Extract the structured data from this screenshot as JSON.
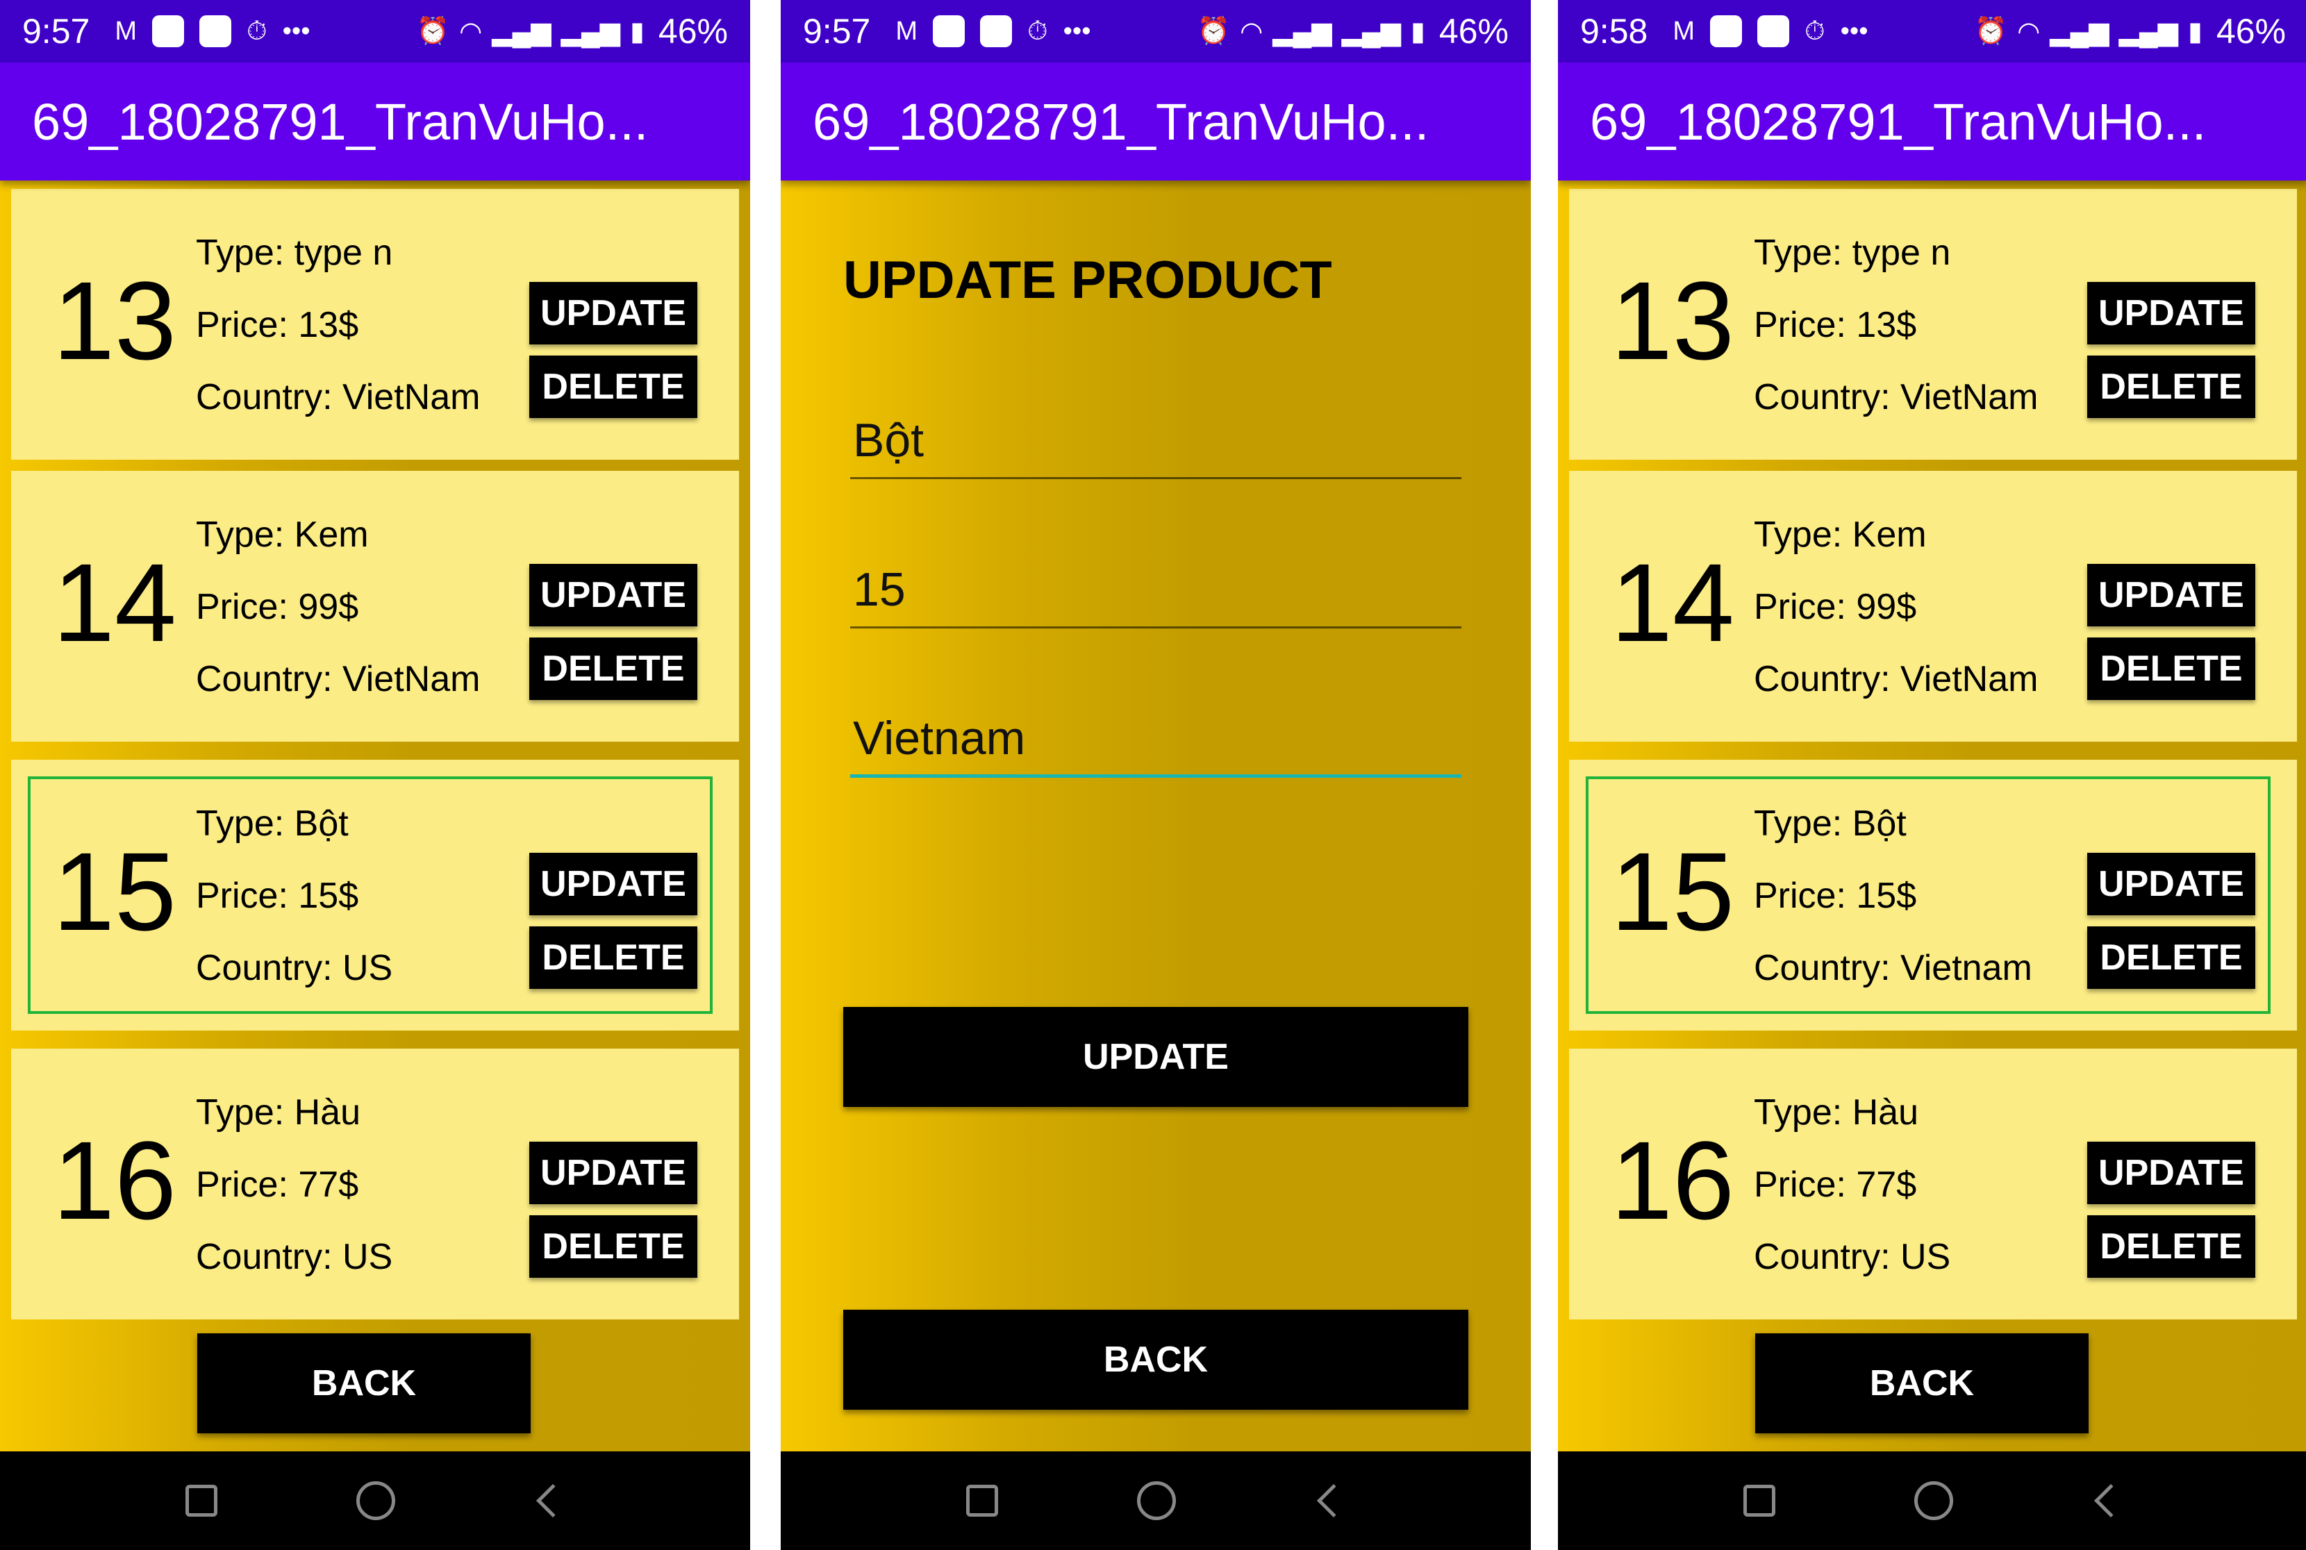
{
  "screens": [
    {
      "status": {
        "time": "9:57",
        "battery": "46%"
      },
      "title": "69_18028791_TranVuHo...",
      "products": [
        {
          "id": "13",
          "type": "Type: type n",
          "price": "Price: 13$",
          "country": "Country: VietNam"
        },
        {
          "id": "14",
          "type": "Type: Kem",
          "price": "Price: 99$",
          "country": "Country: VietNam"
        },
        {
          "id": "15",
          "type": "Type: Bột",
          "price": "Price: 15$",
          "country": "Country: US"
        },
        {
          "id": "16",
          "type": "Type: Hàu",
          "price": "Price: 77$",
          "country": "Country: US"
        }
      ],
      "update_label": "UPDATE",
      "delete_label": "DELETE",
      "back_label": "BACK"
    },
    {
      "status": {
        "time": "9:57",
        "battery": "46%"
      },
      "title": "69_18028791_TranVuHo...",
      "form_title": "UPDATE PRODUCT",
      "fields": {
        "type": "Bột",
        "price": "15",
        "country": "Vietnam"
      },
      "update_label": "UPDATE",
      "back_label": "BACK"
    },
    {
      "status": {
        "time": "9:58",
        "battery": "46%"
      },
      "title": "69_18028791_TranVuHo...",
      "products": [
        {
          "id": "13",
          "type": "Type: type n",
          "price": "Price: 13$",
          "country": "Country: VietNam"
        },
        {
          "id": "14",
          "type": "Type: Kem",
          "price": "Price: 99$",
          "country": "Country: VietNam"
        },
        {
          "id": "15",
          "type": "Type: Bột",
          "price": "Price: 15$",
          "country": "Country: Vietnam"
        },
        {
          "id": "16",
          "type": "Type: Hàu",
          "price": "Price: 77$",
          "country": "Country: US"
        }
      ],
      "update_label": "UPDATE",
      "delete_label": "DELETE",
      "back_label": "BACK"
    }
  ],
  "status_icons": [
    "gmail-icon",
    "app-icon",
    "app-icon",
    "timer-icon",
    "more-icon",
    "alarm-icon",
    "wifi-icon",
    "signal-icon",
    "signal-icon",
    "battery-icon"
  ],
  "colors": {
    "status_bar": "#3f00c8",
    "app_bar": "#6200ee",
    "card": "#fbec85",
    "selection_border": "#22b33a",
    "focus_underline": "#19b5b0",
    "gradient_start": "#f6c800",
    "gradient_end": "#c29b00"
  }
}
